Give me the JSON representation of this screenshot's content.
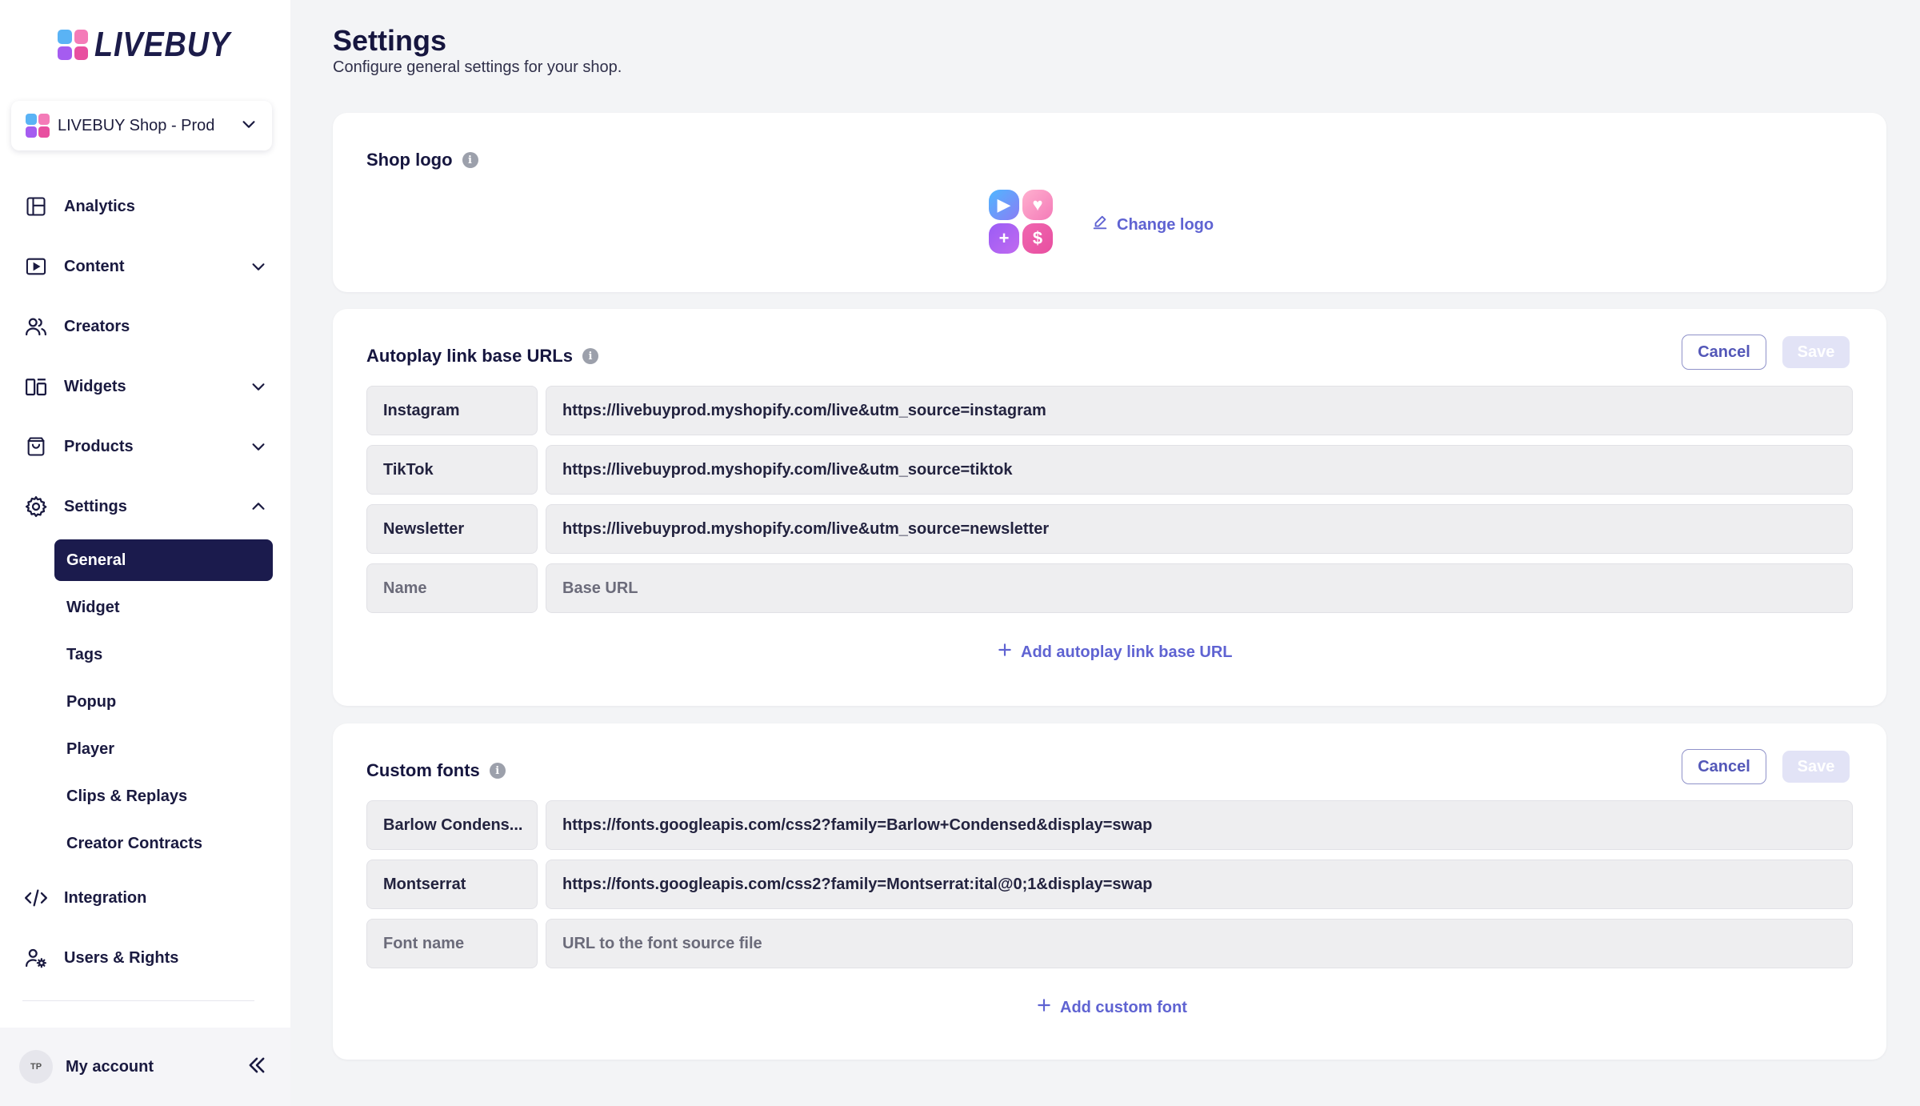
{
  "brand": {
    "name": "LIVEBUY",
    "colors": {
      "navy": "#1b1b4d",
      "accent": "#5f63d2",
      "logo_blue": "#5ab3f5",
      "logo_pink": "#f47bb8",
      "logo_purple": "#a55cf0",
      "logo_magenta": "#e84fa0"
    }
  },
  "shop_switcher": {
    "label": "LIVEBUY Shop - Prod",
    "icon": "chevron-down-icon"
  },
  "nav": {
    "items": [
      {
        "label": "Analytics",
        "icon": "analytics-icon"
      },
      {
        "label": "Content",
        "icon": "play-icon",
        "expandable": true
      },
      {
        "label": "Creators",
        "icon": "users-icon"
      },
      {
        "label": "Widgets",
        "icon": "widgets-icon",
        "expandable": true
      },
      {
        "label": "Products",
        "icon": "bag-icon",
        "expandable": true
      },
      {
        "label": "Settings",
        "icon": "gear-icon",
        "expanded": true
      },
      {
        "label": "Integration",
        "icon": "code-icon"
      },
      {
        "label": "Users & Rights",
        "icon": "user-cog-icon"
      }
    ],
    "settings_sub": [
      "General",
      "Widget",
      "Tags",
      "Popup",
      "Player",
      "Clips & Replays",
      "Creator Contracts"
    ],
    "active_sub": "General"
  },
  "account": {
    "initials": "TP",
    "label": "My account",
    "collapse_icon": "double-chevron-left-icon"
  },
  "page": {
    "title": "Settings",
    "subtitle": "Configure general settings for your shop."
  },
  "shop_logo": {
    "title": "Shop logo",
    "change_label": "Change logo",
    "info": "i"
  },
  "autoplay": {
    "title": "Autoplay link base URLs",
    "info": "i",
    "cancel_label": "Cancel",
    "save_label": "Save",
    "rows": [
      {
        "name": "Instagram",
        "url": "https://livebuyprod.myshopify.com/live&utm_source=instagram"
      },
      {
        "name": "TikTok",
        "url": "https://livebuyprod.myshopify.com/live&utm_source=tiktok"
      },
      {
        "name": "Newsletter",
        "url": "https://livebuyprod.myshopify.com/live&utm_source=newsletter"
      }
    ],
    "new_row": {
      "name_placeholder": "Name",
      "url_placeholder": "Base URL"
    },
    "add_label": "Add autoplay link base URL"
  },
  "fonts": {
    "title": "Custom fonts",
    "info": "i",
    "cancel_label": "Cancel",
    "save_label": "Save",
    "rows": [
      {
        "name": "Barlow Condens...",
        "url": "https://fonts.googleapis.com/css2?family=Barlow+Condensed&display=swap"
      },
      {
        "name": "Montserrat",
        "url": "https://fonts.googleapis.com/css2?family=Montserrat:ital@0;1&display=swap"
      }
    ],
    "new_row": {
      "name_placeholder": "Font name",
      "url_placeholder": "URL to the font source file"
    },
    "add_label": "Add custom font"
  }
}
